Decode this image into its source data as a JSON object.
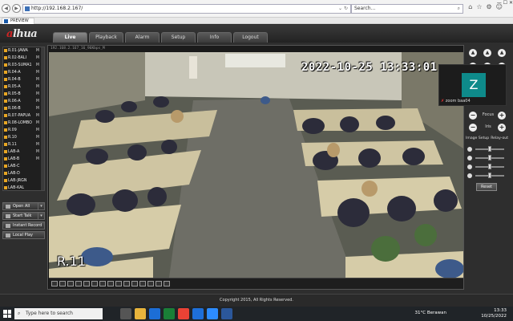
{
  "browser": {
    "address": "http://192.168.2.167/",
    "search_placeholder": "Search...",
    "tab_title": "PREVIEW",
    "window_controls": "— ☐ ✕"
  },
  "app": {
    "logo_prefix": "a",
    "logo_suffix": "lhua",
    "menu": [
      "Live",
      "Playback",
      "Alarm",
      "Setup",
      "Info",
      "Logout"
    ],
    "active_menu": "Live"
  },
  "cameras": [
    {
      "label": "R.01-JAWA",
      "mark": "M"
    },
    {
      "label": "R.02-BALI",
      "mark": "M"
    },
    {
      "label": "R.03-SUMA1",
      "mark": "M"
    },
    {
      "label": "R.04-A",
      "mark": "M"
    },
    {
      "label": "R.04-B",
      "mark": "M"
    },
    {
      "label": "R.05-A",
      "mark": "M"
    },
    {
      "label": "R.05-B",
      "mark": "M"
    },
    {
      "label": "R.06-A",
      "mark": "M"
    },
    {
      "label": "R.06-B",
      "mark": "M"
    },
    {
      "label": "R.07-PAPUA",
      "mark": "M"
    },
    {
      "label": "R.08-LOMBO",
      "mark": "M"
    },
    {
      "label": "R.09",
      "mark": "M"
    },
    {
      "label": "R.10",
      "mark": "M"
    },
    {
      "label": "R.11",
      "mark": "M"
    },
    {
      "label": "LAB-A",
      "mark": "M"
    },
    {
      "label": "LAB-B",
      "mark": "M"
    },
    {
      "label": "LAB-C",
      "mark": ""
    },
    {
      "label": "LAB-D",
      "mark": ""
    },
    {
      "label": "LAB-JRGN",
      "mark": ""
    },
    {
      "label": "LAB-KAL",
      "mark": ""
    }
  ],
  "sidebar_buttons": {
    "open_all": "Open All",
    "start_talk": "Start Talk",
    "instant_record": "Instant Record",
    "local_play": "Local Play"
  },
  "video": {
    "title": "192.168.2.167_16_96Kbps_M",
    "timestamp": "2022-10-25 13:33:01",
    "camera_name": "R.11"
  },
  "ptz": {
    "focus_label": "Focus",
    "iris_label": "Iris",
    "image_setup_tab": "Image Setup",
    "relay_out_tab": "Relay-out",
    "reset_label": "Reset",
    "sliders": [
      {
        "icon": "brightness-icon",
        "value": 0.5
      },
      {
        "icon": "contrast-icon",
        "value": 0.5
      },
      {
        "icon": "saturation-icon",
        "value": 0.5
      },
      {
        "icon": "hue-icon",
        "value": 0.5
      }
    ]
  },
  "zoom_overlay": {
    "initial": "Z",
    "name": "zoom baa04",
    "tile_color": "#0e8a8a"
  },
  "footer": {
    "copyright": "Copyright 2015, All Rights Reserved."
  },
  "taskbar": {
    "search_placeholder": "Type here to search",
    "weather": "31°C  Berawan",
    "time": "13:33",
    "date": "10/25/2022"
  }
}
